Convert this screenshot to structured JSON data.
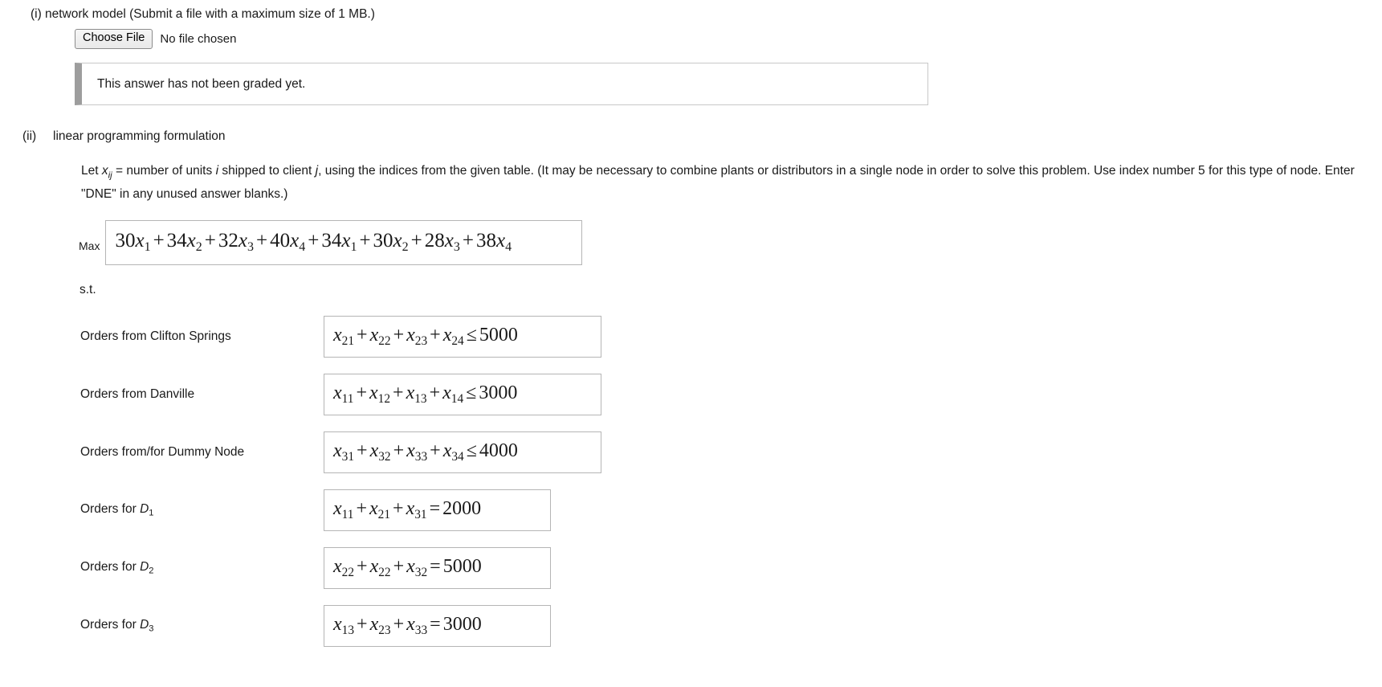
{
  "part_i": {
    "marker": "(i)",
    "prompt": "network model (Submit a file with a maximum size of 1 MB.)",
    "file_input": {
      "button_label": "Choose File",
      "status": "No file chosen"
    },
    "graded_message": "This answer has not been graded yet."
  },
  "part_ii": {
    "marker": "(ii)",
    "title": "linear programming formulation",
    "instructions": {
      "lead": "Let",
      "variable": "x",
      "variable_subscript": "ij",
      "line1_rest": "= number of units",
      "index_i": "i",
      "mid1": "shipped to client",
      "index_j": "j",
      "mid2": ", using the indices from the given table. (It may be necessary to combine plants or distributors in a single node in order to solve this",
      "line2": "problem. Use index number 5 for this type of node. Enter \"DNE\" in any unused answer blanks.)"
    },
    "objective": {
      "label": "Max",
      "terms": [
        {
          "coef": "30",
          "var": "x",
          "sub": "1"
        },
        {
          "coef": "34",
          "var": "x",
          "sub": "2"
        },
        {
          "coef": "32",
          "var": "x",
          "sub": "3"
        },
        {
          "coef": "40",
          "var": "x",
          "sub": "4"
        },
        {
          "coef": "34",
          "var": "x",
          "sub": "1"
        },
        {
          "coef": "30",
          "var": "x",
          "sub": "2"
        },
        {
          "coef": "28",
          "var": "x",
          "sub": "3"
        },
        {
          "coef": "38",
          "var": "x",
          "sub": "4"
        }
      ],
      "expression": "30x1 + 34x2 + 32x3 + 40x4 + 34x1 + 30x2 + 28x3 + 38x4"
    },
    "subject_to_label": "s.t.",
    "constraints": [
      {
        "label": "Orders from Clifton Springs",
        "label_sub": "",
        "terms": [
          {
            "var": "x",
            "sub": "21"
          },
          {
            "var": "x",
            "sub": "22"
          },
          {
            "var": "x",
            "sub": "23"
          },
          {
            "var": "x",
            "sub": "24"
          }
        ],
        "relation": "≤",
        "rhs": "5000",
        "box_width": "w-lg"
      },
      {
        "label": "Orders from Danville",
        "label_sub": "",
        "terms": [
          {
            "var": "x",
            "sub": "11"
          },
          {
            "var": "x",
            "sub": "12"
          },
          {
            "var": "x",
            "sub": "13"
          },
          {
            "var": "x",
            "sub": "14"
          }
        ],
        "relation": "≤",
        "rhs": "3000",
        "box_width": "w-lg"
      },
      {
        "label": "Orders from/for Dummy Node",
        "label_sub": "",
        "terms": [
          {
            "var": "x",
            "sub": "31"
          },
          {
            "var": "x",
            "sub": "32"
          },
          {
            "var": "x",
            "sub": "33"
          },
          {
            "var": "x",
            "sub": "34"
          }
        ],
        "relation": "≤",
        "rhs": "4000",
        "box_width": "w-lg"
      },
      {
        "label": "Orders for D",
        "label_sub": "1",
        "terms": [
          {
            "var": "x",
            "sub": "11"
          },
          {
            "var": "x",
            "sub": "21"
          },
          {
            "var": "x",
            "sub": "31"
          }
        ],
        "relation": "=",
        "rhs": "2000",
        "box_width": "w-md"
      },
      {
        "label": "Orders for D",
        "label_sub": "2",
        "terms": [
          {
            "var": "x",
            "sub": "22"
          },
          {
            "var": "x",
            "sub": "22"
          },
          {
            "var": "x",
            "sub": "32"
          }
        ],
        "relation": "=",
        "rhs": "5000",
        "box_width": "w-md"
      },
      {
        "label": "Orders for D",
        "label_sub": "3",
        "terms": [
          {
            "var": "x",
            "sub": "13"
          },
          {
            "var": "x",
            "sub": "23"
          },
          {
            "var": "x",
            "sub": "33"
          }
        ],
        "relation": "=",
        "rhs": "3000",
        "box_width": "w-md"
      }
    ]
  },
  "colors": {
    "text": "#1a1a1a",
    "box_border": "#b5b5b5",
    "panel_border": "#c8c8c8",
    "panel_accent": "#9d9d9d"
  }
}
